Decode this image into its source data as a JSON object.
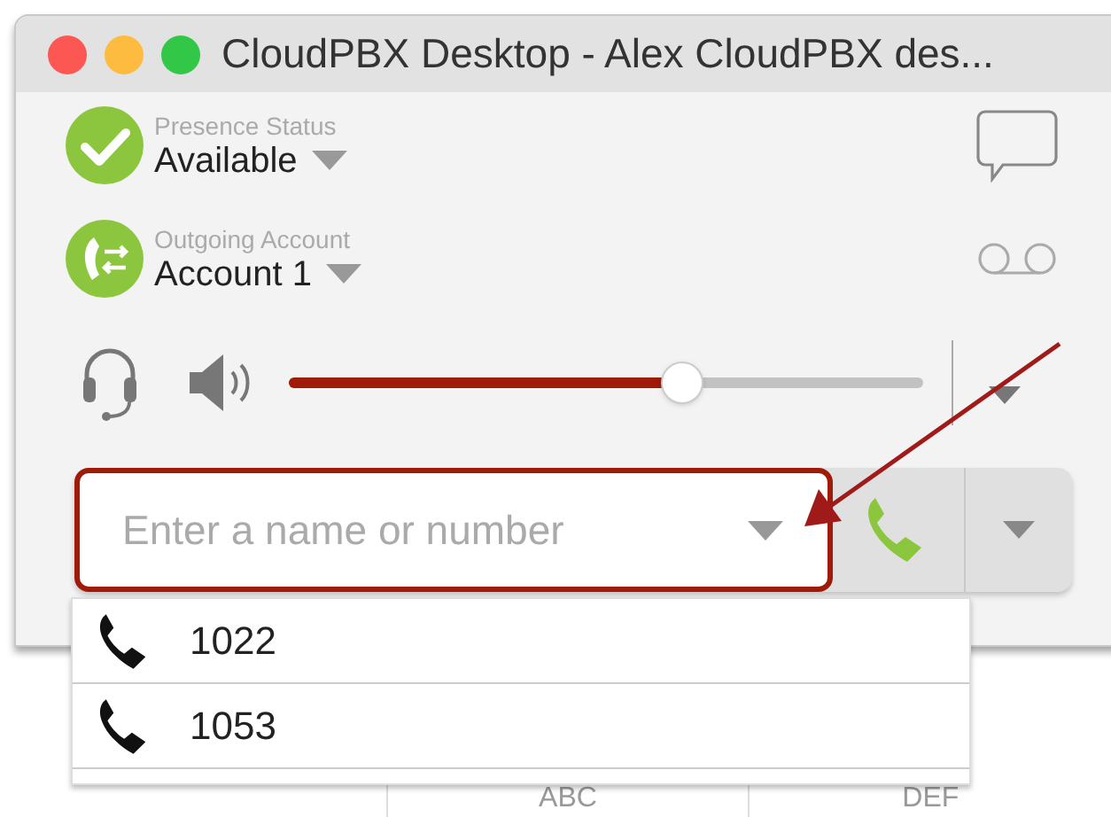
{
  "window": {
    "title": "CloudPBX Desktop - Alex CloudPBX des..."
  },
  "presence": {
    "label": "Presence Status",
    "value": "Available"
  },
  "account": {
    "label": "Outgoing Account",
    "value": "Account 1"
  },
  "volume": {
    "level": 0.62
  },
  "dial_field": {
    "placeholder": "Enter a name or number",
    "focused": true
  },
  "suggestions": [
    {
      "number": "1022"
    },
    {
      "number": "1053"
    }
  ],
  "keypad": [
    {
      "letters": "ABC"
    },
    {
      "letters": "DEF"
    }
  ]
}
